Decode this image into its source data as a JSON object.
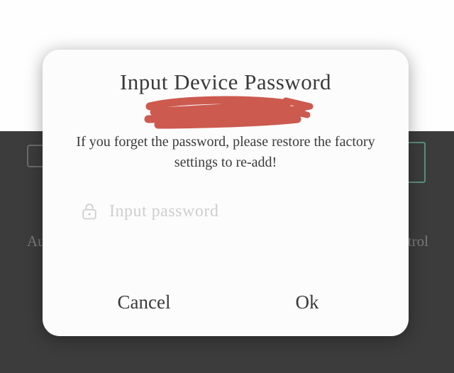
{
  "background": {
    "left_label": "Aut",
    "right_label": "trol"
  },
  "dialog": {
    "title": "Input Device Password",
    "message": "If you forget the password, please restore the factory settings to re-add!",
    "password_placeholder": "Input password",
    "password_value": "",
    "buttons": {
      "cancel": "Cancel",
      "ok": "Ok"
    }
  }
}
